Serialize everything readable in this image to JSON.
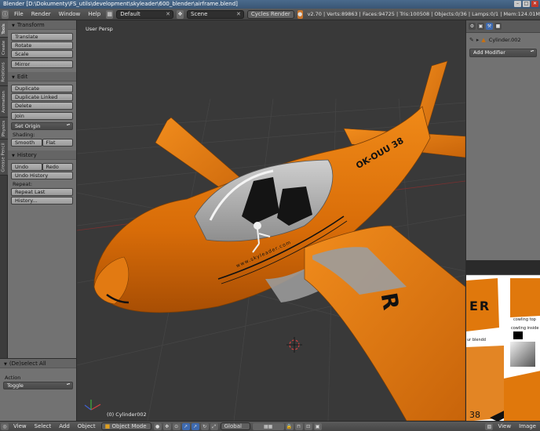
{
  "window": {
    "title": "Blender [D:\\Dokumenty\\FS_utils\\development\\skyleader\\600_blender\\airframe.blend]",
    "controls": [
      "–",
      "□",
      "✕"
    ]
  },
  "info_header": {
    "menus": [
      "File",
      "Render",
      "Window",
      "Help"
    ],
    "layout": "Default",
    "scene": "Scene",
    "engine": "Cycles Render",
    "stats": "v2.70 | Verts:89863 | Faces:94725 | Tris:100508 | Objects:0/36 | Lamps:0/1 | Mem:124.01M"
  },
  "tabs": [
    "Tools",
    "Create",
    "Relations",
    "Animation",
    "Physics",
    "Grease Pencil"
  ],
  "tool_shelf": {
    "transform": {
      "title": "Transform",
      "buttons": [
        "Translate",
        "Rotate",
        "Scale"
      ],
      "mirror": "Mirror"
    },
    "edit": {
      "title": "Edit",
      "buttons": [
        "Duplicate",
        "Duplicate Linked",
        "Delete"
      ],
      "join": "Join",
      "set_origin": "Set Origin",
      "shading_label": "Shading:",
      "smooth": "Smooth",
      "flat": "Flat"
    },
    "history": {
      "title": "History",
      "undo": "Undo",
      "redo": "Redo",
      "undo_history": "Undo History",
      "repeat_label": "Repeat:",
      "repeat_last": "Repeat Last",
      "history": "History..."
    }
  },
  "operator": {
    "title": "(De)select All",
    "action_label": "Action",
    "action_value": "Toggle"
  },
  "viewport": {
    "view_name": "User Persp",
    "object_label": "(0) Cylinder002",
    "registration": "OK-OUU 38",
    "brand": "www.skyleader.com",
    "wing_letters": "R"
  },
  "properties": {
    "object": "Cylinder.002",
    "add_modifier": "Add Modifier"
  },
  "uv_editor": {
    "label_1": "cowling top",
    "label_2": "cowling inside",
    "label_3": "ur blendd",
    "big_text": "ER",
    "number": "38",
    "menus": [
      "View",
      "Image"
    ]
  },
  "bottom_header": {
    "menus": [
      "View",
      "Select",
      "Add",
      "Object"
    ],
    "mode": "Object Mode",
    "orientation": "Global"
  },
  "colors": {
    "plane_orange": "#e0780c",
    "viewport_bg": "#393939",
    "panel_grey": "#727272",
    "header_grey": "#4f4f4f"
  }
}
